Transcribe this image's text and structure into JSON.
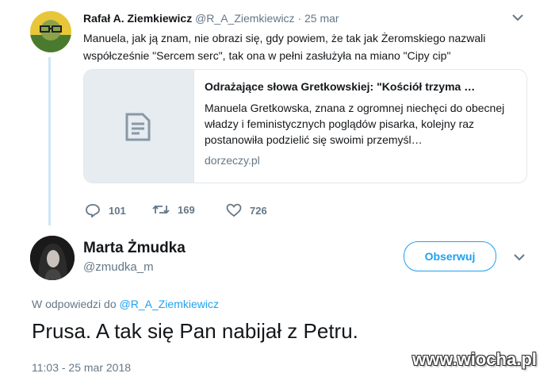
{
  "tweet1": {
    "author_name": "Rafał A. Ziemkiewicz",
    "handle": "@R_A_Ziemkiewicz",
    "separator": "·",
    "date": "25 mar",
    "text": "Manuela, jak ją znam, nie obrazi się, gdy powiem, że tak jak Żeromskiego nazwali współcześnie \"Sercem serc\", tak ona w pełni zasłużyła na miano \"Cipy cip\"",
    "card": {
      "title": "Odrażające słowa Gretkowskiej: \"Kościół trzyma …",
      "description": "Manuela Gretkowska, znana z ogromnej niechęci do obecnej władzy i feministycznych poglądów pisarka, kolejny raz postanowiła podzielić się swoimi przemyśl…",
      "domain": "dorzeczy.pl",
      "thumb_icon": "document-icon"
    },
    "actions": {
      "replies": "101",
      "retweets": "169",
      "likes": "726"
    }
  },
  "tweet2": {
    "author_name": "Marta Żmudka",
    "handle": "@zmudka_m",
    "follow_label": "Obserwuj",
    "reply_prefix": "W odpowiedzi do",
    "reply_handle": "@R_A_Ziemkiewicz",
    "text": "Prusa. A tak się Pan nabijał z Petru.",
    "timestamp": "11:03 - 25 mar 2018"
  },
  "watermark": "www.wiocha.pl",
  "colors": {
    "accent": "#1da1f2",
    "muted": "#657786",
    "thread_line": "#cde7f5"
  }
}
